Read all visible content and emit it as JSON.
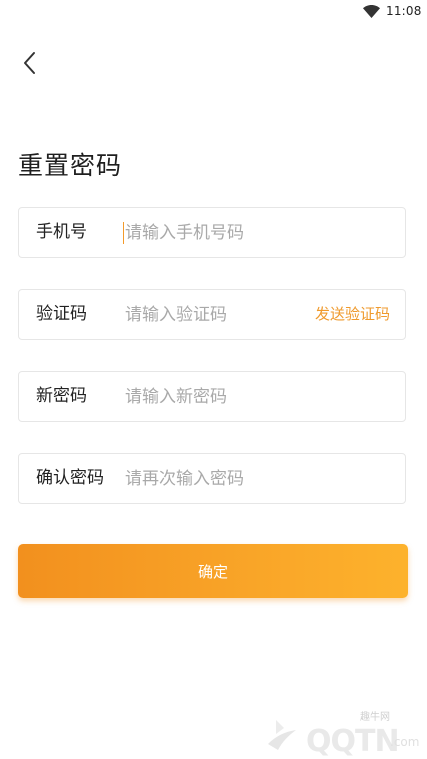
{
  "status_bar": {
    "time": "11:08",
    "icons": [
      "wifi-icon"
    ]
  },
  "nav": {
    "back_icon": "chevron-left-icon"
  },
  "page": {
    "title": "重置密码"
  },
  "form": {
    "phone": {
      "label": "手机号",
      "placeholder": "请输入手机号码",
      "value": ""
    },
    "code": {
      "label": "验证码",
      "placeholder": "请输入验证码",
      "value": "",
      "send_label": "发送验证码"
    },
    "new_password": {
      "label": "新密码",
      "placeholder": "请输入新密码",
      "value": ""
    },
    "confirm_password": {
      "label": "确认密码",
      "placeholder": "请再次输入密码",
      "value": ""
    }
  },
  "confirm_button": {
    "label": "确定"
  },
  "watermark": {
    "site": "趣牛网",
    "brand": "QQTN",
    "tld": ".com"
  },
  "colors": {
    "accent": "#ef9a2d",
    "button_start": "#f2901e",
    "button_end": "#fdb22c",
    "field_border": "#e6e6e6",
    "placeholder": "#a9a9a9"
  }
}
